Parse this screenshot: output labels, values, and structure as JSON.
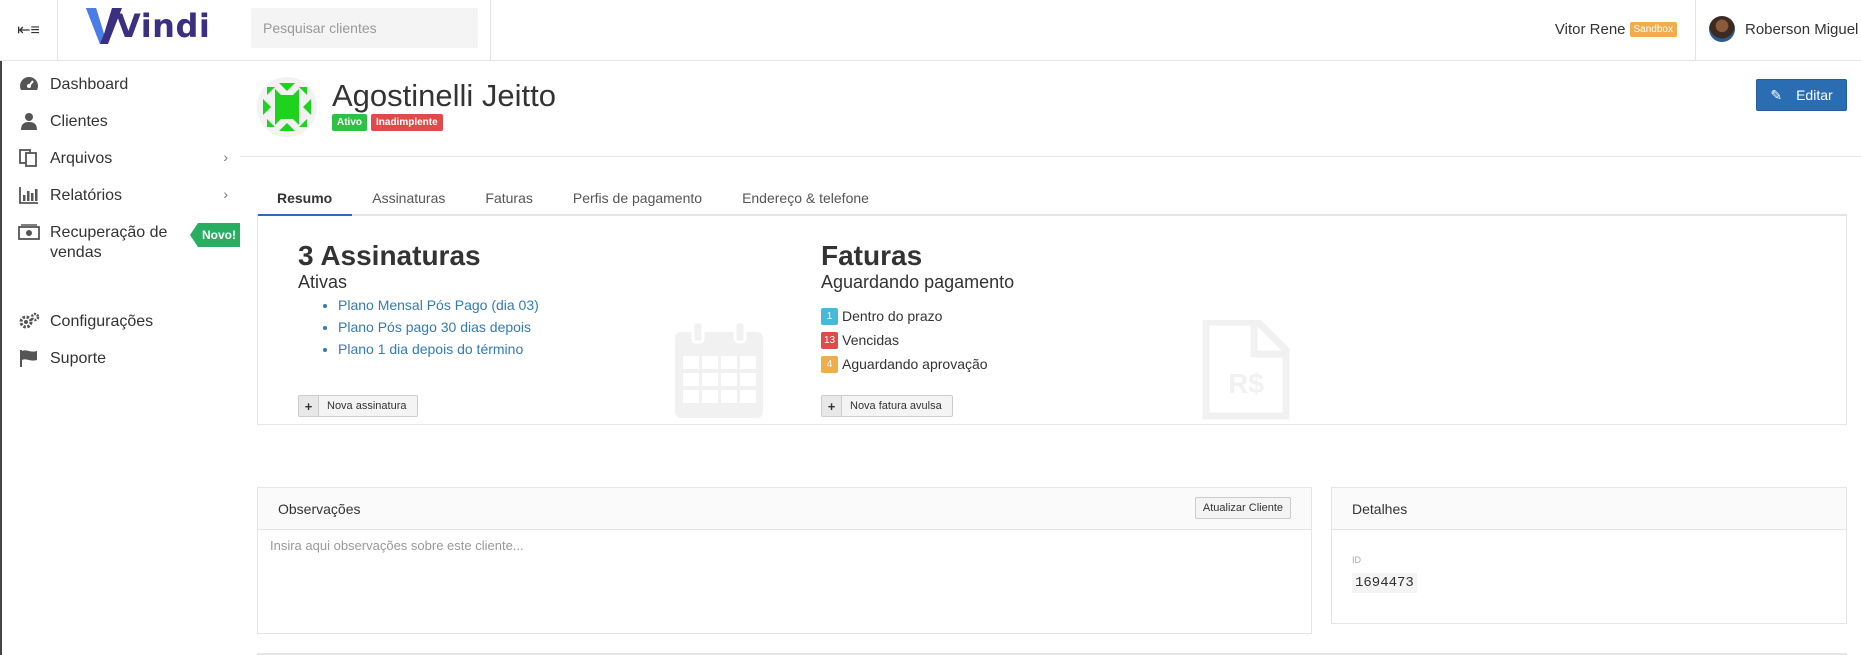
{
  "brand": {
    "name": "Vindi",
    "color": "#3b2f82"
  },
  "search": {
    "placeholder": "Pesquisar clientes"
  },
  "account": {
    "name": "Vitor Rene",
    "env_badge": "Sandbox"
  },
  "user": {
    "name": "Roberson Miguel"
  },
  "sidebar": {
    "items": [
      {
        "label": "Dashboard",
        "icon": "dashboard-icon"
      },
      {
        "label": "Clientes",
        "icon": "user-icon"
      },
      {
        "label": "Arquivos",
        "icon": "files-icon",
        "has_submenu": true
      },
      {
        "label": "Relatórios",
        "icon": "bar-chart-icon",
        "has_submenu": true
      },
      {
        "label": "Recuperação de vendas",
        "icon": "money-icon",
        "badge": "Novo!"
      },
      {
        "label": "Configurações",
        "icon": "gears-icon"
      },
      {
        "label": "Suporte",
        "icon": "flag-icon"
      }
    ]
  },
  "customer": {
    "name": "Agostinelli Jeitto",
    "status_badges": [
      "Ativo",
      "Inadimplente"
    ],
    "edit_label": "Editar"
  },
  "tabs": [
    "Resumo",
    "Assinaturas",
    "Faturas",
    "Perfis de pagamento",
    "Endereço & telefone"
  ],
  "active_tab": "Resumo",
  "subscriptions": {
    "title": "3 Assinaturas",
    "subtitle": "Ativas",
    "plans": [
      "Plano Mensal Pós Pago (dia 03)",
      "Plano Pós pago 30 dias depois",
      "Plano 1 dia depois do término"
    ],
    "new_button": "Nova assinatura"
  },
  "invoices": {
    "title": "Faturas",
    "subtitle": "Aguardando pagamento",
    "lines": [
      {
        "count": "1",
        "label": "Dentro do prazo",
        "color": "#48b9d9"
      },
      {
        "count": "13",
        "label": "Vencidas",
        "color": "#e04b4a"
      },
      {
        "count": "4",
        "label": "Aguardando aprovação",
        "color": "#f0ad4e"
      }
    ],
    "new_button": "Nova fatura avulsa",
    "bg_icon_text": "R$"
  },
  "notes": {
    "title": "Observações",
    "update_button": "Atualizar Cliente",
    "placeholder": "Insira aqui observações sobre este cliente..."
  },
  "details": {
    "title": "Detalhes",
    "id_label": "ID",
    "id_value": "1694473"
  },
  "colors": {
    "primary": "#2a6db3",
    "success": "#2ec245",
    "danger": "#e04b4a",
    "warning": "#f0ad4e",
    "info": "#48b9d9",
    "link": "#337ab7"
  }
}
